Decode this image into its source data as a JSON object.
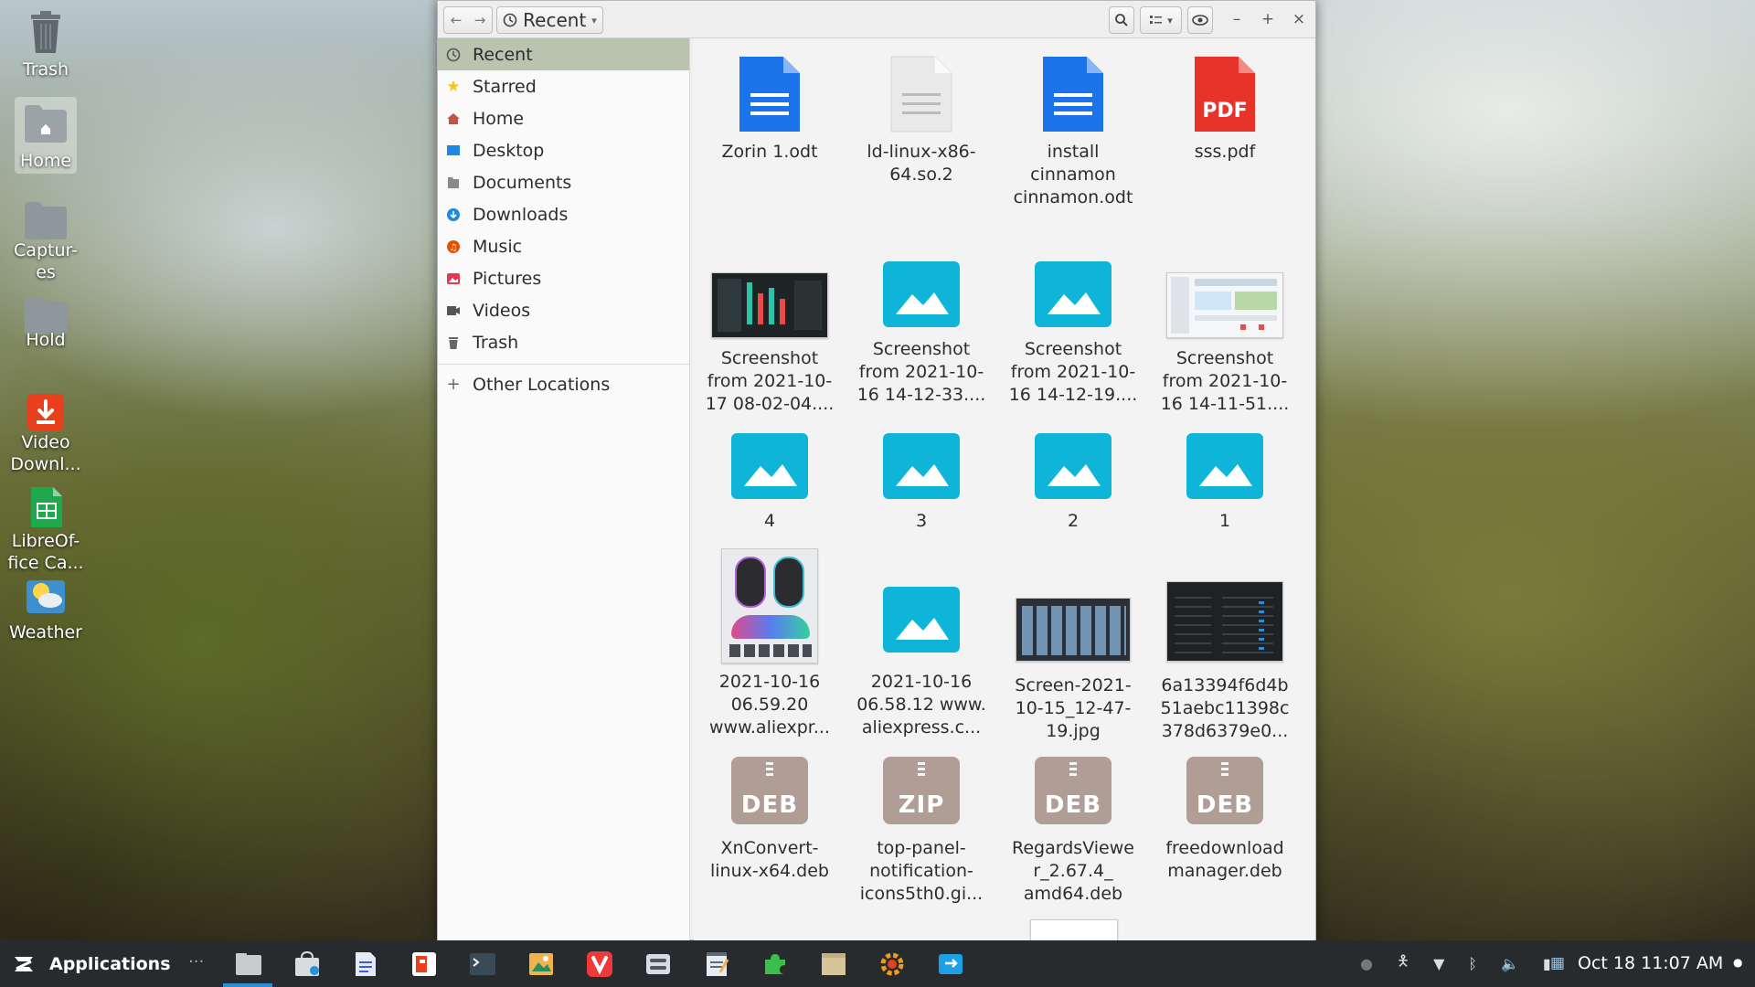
{
  "desktop": {
    "icons": [
      {
        "label": "Trash"
      },
      {
        "label": "Home"
      },
      {
        "label": "Captur-\nes"
      },
      {
        "label": "Hold"
      },
      {
        "label": "Video\nDownl..."
      },
      {
        "label": "LibreOf-\nfice Ca..."
      },
      {
        "label": "Weather"
      }
    ]
  },
  "window": {
    "location_label": "Recent",
    "sidebar": {
      "items": [
        {
          "label": "Recent",
          "icon": "clock-icon",
          "color": "#555555"
        },
        {
          "label": "Starred",
          "icon": "star-icon",
          "color": "#f5c518"
        },
        {
          "label": "Home",
          "icon": "home-icon",
          "color": "#c0564a"
        },
        {
          "label": "Desktop",
          "icon": "desktop-icon",
          "color": "#1e88e5"
        },
        {
          "label": "Documents",
          "icon": "documents-icon",
          "color": "#8a8a8a"
        },
        {
          "label": "Downloads",
          "icon": "downloads-icon",
          "color": "#1e88e5"
        },
        {
          "label": "Music",
          "icon": "music-icon",
          "color": "#e65100"
        },
        {
          "label": "Pictures",
          "icon": "pictures-icon",
          "color": "#e53950"
        },
        {
          "label": "Videos",
          "icon": "videos-icon",
          "color": "#555555"
        },
        {
          "label": "Trash",
          "icon": "trash-icon",
          "color": "#666666"
        }
      ],
      "other_locations": "Other Locations"
    },
    "files": [
      {
        "name": "Zorin 1.odt",
        "kind": "doc-blue"
      },
      {
        "name": "ld-linux-x86-\n64.so.2",
        "kind": "doc-grey"
      },
      {
        "name": "install\ncinnamon\ncinnamon.odt",
        "kind": "doc-blue"
      },
      {
        "name": "sss.pdf",
        "kind": "pdf",
        "badge": "PDF"
      },
      {
        "name": "Screenshot\nfrom 2021-10-\n17 08-02-04....",
        "kind": "thumb-dark"
      },
      {
        "name": "Screenshot\nfrom 2021-10-\n16 14-12-33....",
        "kind": "image"
      },
      {
        "name": "Screenshot\nfrom 2021-10-\n16 14-12-19....",
        "kind": "image"
      },
      {
        "name": "Screenshot\nfrom 2021-10-\n16 14-11-51....",
        "kind": "thumb-light"
      },
      {
        "name": "4",
        "kind": "image"
      },
      {
        "name": "3",
        "kind": "image"
      },
      {
        "name": "2",
        "kind": "image"
      },
      {
        "name": "1",
        "kind": "image"
      },
      {
        "name": "2021-10-16\n06.59.20\nwww.aliexpr...",
        "kind": "thumb-mouse"
      },
      {
        "name": "2021-10-16\n06.58.12 www.\naliexpress.c...",
        "kind": "image"
      },
      {
        "name": "Screen-2021-\n10-15_12-47-\n19.jpg",
        "kind": "thumb-grid"
      },
      {
        "name": "6a13394f6d4b\n51aebc11398c\n378d6379e0...",
        "kind": "thumb-black"
      },
      {
        "name": "XnConvert-\nlinux-x64.deb",
        "kind": "pkg",
        "badge": "DEB"
      },
      {
        "name": "top-panel-\nnotification-\nicons5th0.gi...",
        "kind": "pkg",
        "badge": "ZIP"
      },
      {
        "name": "RegardsViewe\nr_2.67.4_\namd64.deb",
        "kind": "pkg",
        "badge": "DEB"
      },
      {
        "name": "freedownload\nmanager.deb",
        "kind": "pkg",
        "badge": "DEB"
      }
    ]
  },
  "taskbar": {
    "applications_label": "Applications",
    "more_label": "···",
    "clock": "Oct 18 11:07 AM"
  }
}
